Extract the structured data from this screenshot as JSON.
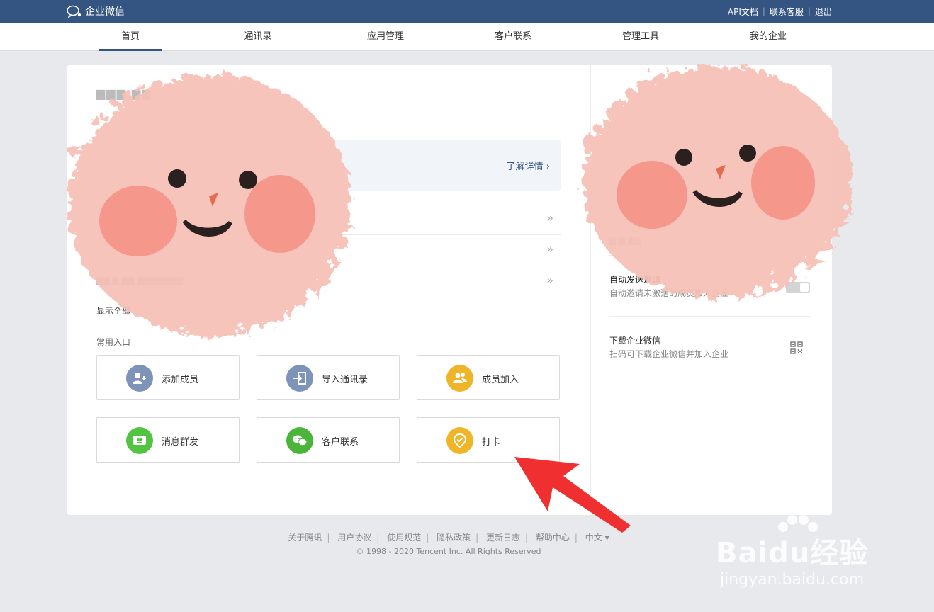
{
  "topbar": {
    "logo_text": "企业微信",
    "links": [
      "API文档",
      "联系客服",
      "退出"
    ],
    "separator": "|",
    "color": "#345482"
  },
  "nav": {
    "tabs": [
      {
        "label": "首页",
        "active": true
      },
      {
        "label": "通讯录",
        "active": false
      },
      {
        "label": "应用管理",
        "active": false
      },
      {
        "label": "客户联系",
        "active": false
      },
      {
        "label": "管理工具",
        "active": false
      },
      {
        "label": "我的企业",
        "active": false
      }
    ]
  },
  "main": {
    "notice_link": "了解详情 ›",
    "list_arrow": "»",
    "show_all": "显示全部",
    "shortcuts_title": "常用入口",
    "shortcuts": [
      {
        "label": "添加成员",
        "icon": "add-member-icon",
        "color": "#7d93b8"
      },
      {
        "label": "导入通讯录",
        "icon": "import-contacts-icon",
        "color": "#7d93b8"
      },
      {
        "label": "成员加入",
        "icon": "members-join-icon",
        "color": "#f0b429"
      },
      {
        "label": "消息群发",
        "icon": "broadcast-icon",
        "color": "#52c441"
      },
      {
        "label": "客户联系",
        "icon": "customer-contact-icon",
        "color": "#4bb43a"
      },
      {
        "label": "打卡",
        "icon": "check-in-icon",
        "color": "#f0b429"
      }
    ]
  },
  "side": {
    "auto_invite": {
      "title": "自动发送邀请",
      "desc": "自动邀请未激活的成员加入企业"
    },
    "download": {
      "title": "下载企业微信",
      "desc": "扫码可下载企业微信并加入企业"
    }
  },
  "footer": {
    "links": [
      "关于腾讯",
      "用户协议",
      "使用规范",
      "隐私政策",
      "更新日志",
      "帮助中心",
      "中文 ▾"
    ],
    "copyright": "© 1998 - 2020 Tencent Inc. All Rights Reserved"
  },
  "watermark": {
    "main": "Baidu经验",
    "sub": "jingyan.baidu.com"
  },
  "colors": {
    "sticker_blush": "#f6a89c",
    "annotation_arrow": "#f03030"
  }
}
